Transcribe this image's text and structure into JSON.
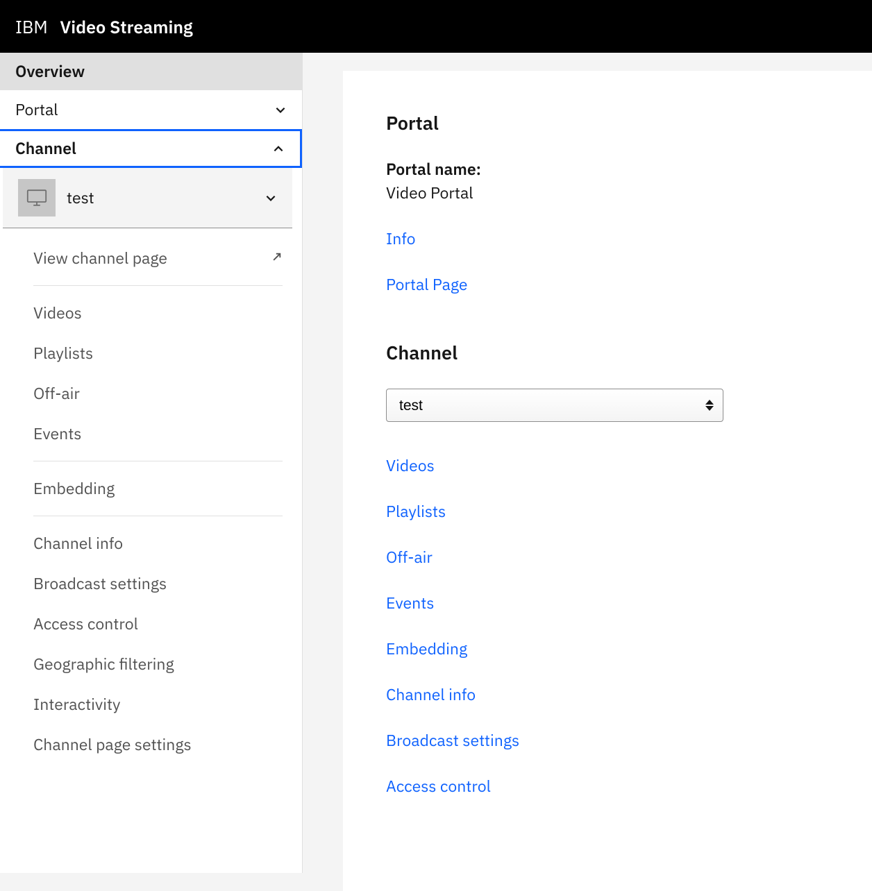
{
  "header": {
    "brand_light": "IBM",
    "brand_bold": "Video Streaming"
  },
  "sidebar": {
    "overview": "Overview",
    "portal": "Portal",
    "channel": "Channel",
    "channel_selected": "test",
    "items": {
      "view_channel_page": "View channel page",
      "videos": "Videos",
      "playlists": "Playlists",
      "off_air": "Off-air",
      "events": "Events",
      "embedding": "Embedding",
      "channel_info": "Channel info",
      "broadcast_settings": "Broadcast settings",
      "access_control": "Access control",
      "geographic_filtering": "Geographic filtering",
      "interactivity": "Interactivity",
      "channel_page_settings": "Channel page settings"
    }
  },
  "main": {
    "portal": {
      "heading": "Portal",
      "name_label": "Portal name:",
      "name_value": "Video Portal",
      "links": {
        "info": "Info",
        "portal_page": "Portal Page"
      }
    },
    "channel": {
      "heading": "Channel",
      "selected": "test",
      "links": {
        "videos": "Videos",
        "playlists": "Playlists",
        "off_air": "Off-air",
        "events": "Events",
        "embedding": "Embedding",
        "channel_info": "Channel info",
        "broadcast_settings": "Broadcast settings",
        "access_control": "Access control"
      }
    }
  }
}
